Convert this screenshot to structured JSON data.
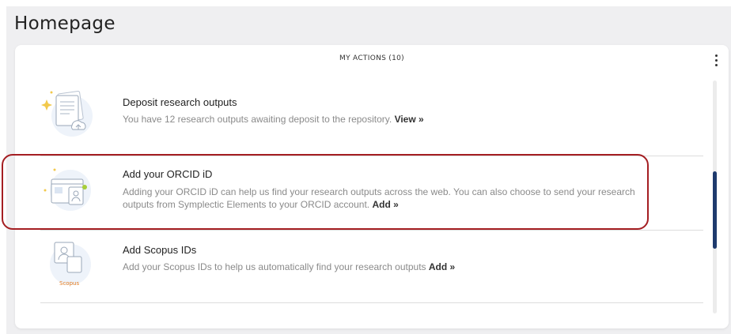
{
  "page": {
    "title": "Homepage"
  },
  "actions_card": {
    "title": "MY ACTIONS (10)",
    "items": [
      {
        "title": "Deposit research outputs",
        "description": "You have 12 research outputs awaiting deposit to the repository.",
        "link": "View »",
        "icon": "document-stack-icon"
      },
      {
        "title": "Add your ORCID iD",
        "description": "Adding your ORCID iD can help us find your research outputs across the web. You can also choose to send your research outputs from Symplectic Elements to your ORCID account.",
        "link": "Add »",
        "icon": "profile-window-icon"
      },
      {
        "title": "Add Scopus IDs",
        "description": "Add your Scopus IDs to help us automatically find your research outputs",
        "link": "Add »",
        "icon": "scopus-profile-icon",
        "icon_text": "Scopus"
      }
    ]
  },
  "colors": {
    "highlight": "#a41e22",
    "scroll_thumb": "#1e3a6d",
    "icon_accent": "#f2c94c",
    "icon_blue": "#c9d9ee"
  }
}
